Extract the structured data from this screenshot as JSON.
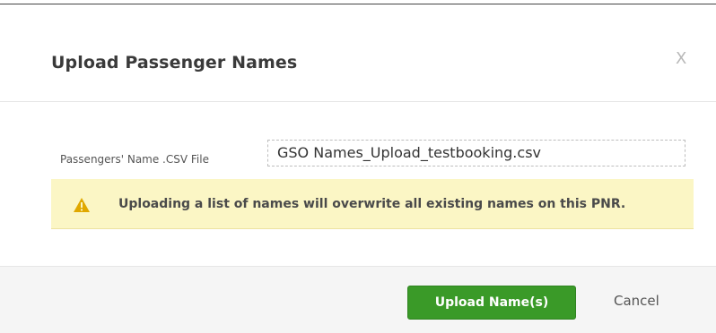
{
  "modal": {
    "title": "Upload Passenger Names",
    "close_label": "X"
  },
  "form": {
    "file_label": "Passengers' Name .CSV File",
    "file_name": "GSO Names_Upload_testbooking.csv"
  },
  "warning": {
    "icon": "warning-triangle-icon",
    "text": "Uploading a list of names will overwrite all existing names on this PNR."
  },
  "footer": {
    "upload_label": "Upload Name(s)",
    "cancel_label": "Cancel"
  },
  "colors": {
    "primary_button": "#3a9a28",
    "warning_background": "#fbf6c5",
    "warning_icon": "#e0a800"
  }
}
